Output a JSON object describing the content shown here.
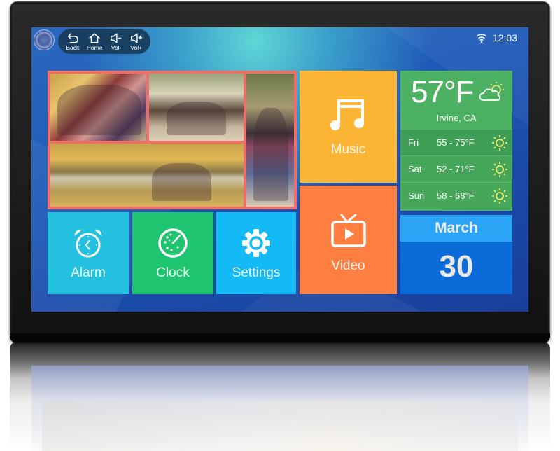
{
  "nav": {
    "buttons": [
      {
        "label": "Back",
        "icon": "back-arrow-icon"
      },
      {
        "label": "Home",
        "icon": "home-icon"
      },
      {
        "label": "Vol-",
        "icon": "volume-down-icon"
      },
      {
        "label": "Vol+",
        "icon": "volume-up-icon"
      }
    ]
  },
  "status_bar": {
    "wifi_icon": "wifi-icon",
    "time": "12:03"
  },
  "photo_collage": {
    "border_color": "#f06e6a",
    "photos": [
      "family-portrait-photo",
      "family-walk-photo",
      "family-lakeside-photo",
      "mother-daughter-photo"
    ]
  },
  "tiles": {
    "music": {
      "label": "Music",
      "icon": "music-note-icon",
      "color": "#fcb534"
    },
    "video": {
      "label": "Video",
      "icon": "tv-play-icon",
      "color": "#fe7f40"
    },
    "alarm": {
      "label": "Alarm",
      "icon": "alarm-clock-icon",
      "color": "#23c1df"
    },
    "clock": {
      "label": "Clock",
      "icon": "clock-dial-icon",
      "color": "#1ec46f"
    },
    "settings": {
      "label": "Settings",
      "icon": "gear-icon",
      "color": "#13baf5"
    }
  },
  "weather": {
    "current_temp": "57°F",
    "condition_icon": "partly-cloudy-icon",
    "location": "Irvine, CA",
    "forecast": [
      {
        "day": "Fri",
        "range": "55 - 75°F",
        "icon": "sun-icon"
      },
      {
        "day": "Sat",
        "range": "52 - 71°F",
        "icon": "sun-icon"
      },
      {
        "day": "Sun",
        "range": "58 - 68°F",
        "icon": "sun-icon"
      }
    ],
    "color": "#4db163"
  },
  "calendar": {
    "month": "March",
    "day": "30",
    "month_color": "#2ba4f5",
    "day_color": "#0b6bd8"
  }
}
